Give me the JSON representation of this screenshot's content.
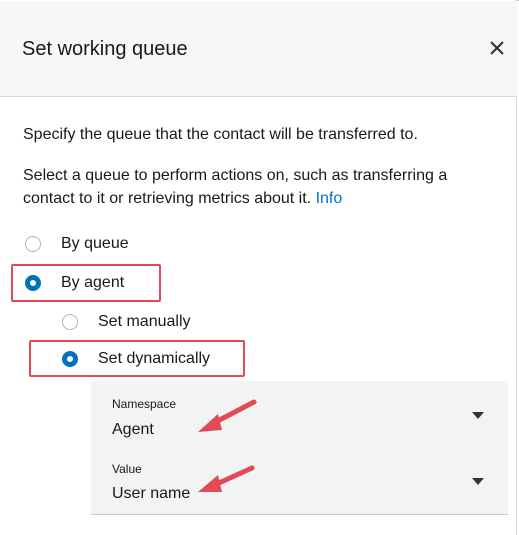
{
  "modal": {
    "title": "Set working queue",
    "close_icon": "close-icon"
  },
  "description": {
    "line1": "Specify the queue that the contact will be transferred to.",
    "line2": "Select a queue to perform actions on, such as transferring a contact to it or retrieving metrics about it.",
    "info_link": "Info"
  },
  "options": {
    "by_queue": "By queue",
    "by_agent": "By agent",
    "selected": "By agent",
    "sub_options": {
      "set_manually": "Set manually",
      "set_dynamically": "Set dynamically",
      "selected": "Set dynamically"
    }
  },
  "fields": {
    "namespace": {
      "label": "Namespace",
      "value": "Agent"
    },
    "value": {
      "label": "Value",
      "value": "User name"
    }
  },
  "colors": {
    "accent": "#0073bb",
    "highlight": "#e04b55",
    "panel_bg": "#f2f3f3",
    "header_bg": "#f7f7f7"
  }
}
